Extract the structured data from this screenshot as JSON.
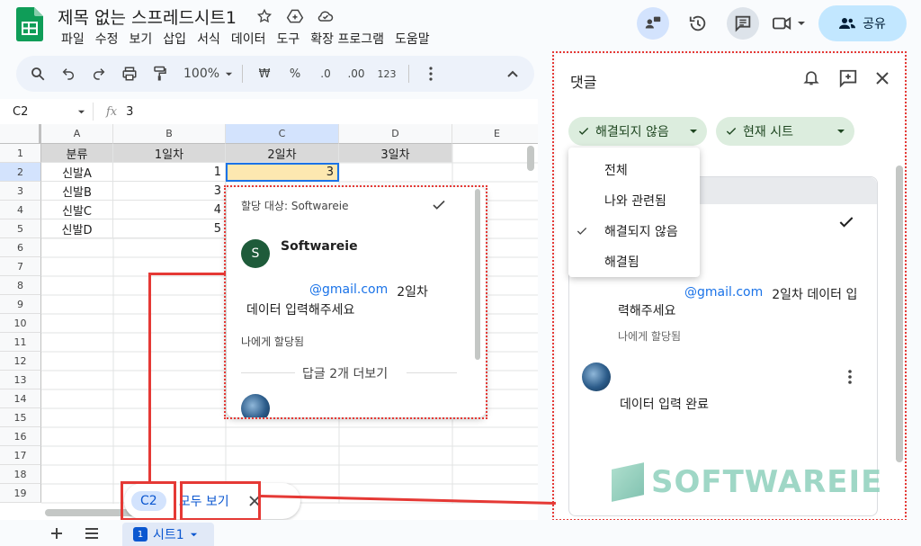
{
  "header": {
    "title": "제목 없는 스프레드시트1",
    "menu": [
      "파일",
      "수정",
      "보기",
      "삽입",
      "서식",
      "데이터",
      "도구",
      "확장 프로그램",
      "도움말"
    ],
    "share_label": "공유"
  },
  "toolbar": {
    "zoom": "100%",
    "currency": "₩",
    "percent": "%",
    "dec_dec": ".0",
    "inc_dec": ".00",
    "format_123": "123"
  },
  "formula_bar": {
    "cell_ref": "C2",
    "fx": "fx",
    "value": "3"
  },
  "grid": {
    "columns": [
      "A",
      "B",
      "C",
      "D",
      "E"
    ],
    "rows": [
      "1",
      "2",
      "3",
      "4",
      "5",
      "6",
      "7",
      "8",
      "9",
      "10",
      "11",
      "12",
      "13",
      "14",
      "15",
      "16",
      "17",
      "18",
      "19"
    ],
    "header_row": [
      "분류",
      "1일차",
      "2일차",
      "3일차"
    ],
    "data": [
      {
        "a": "신발A",
        "b": "1",
        "c": "3"
      },
      {
        "a": "신발B",
        "b": "3",
        "c": ""
      },
      {
        "a": "신발C",
        "b": "4",
        "c": ""
      },
      {
        "a": "신발D",
        "b": "5",
        "c": ""
      }
    ]
  },
  "popup": {
    "assigned": "할당 대상: Softwareie",
    "author": "Softwareie",
    "avatar_letter": "S",
    "email": "@gmail.com",
    "text_a": "2일차",
    "text_b": "데이터 입력해주세요",
    "assigned_to_me": "나에게 할당됨",
    "more_replies": "답글 2개 더보기"
  },
  "explore_bar": {
    "cell_chip": "C2",
    "see_all": "모두 보기"
  },
  "panel": {
    "title": "댓글",
    "filter_status": "해결되지 않음",
    "filter_sheet": "현재 시트",
    "dropdown": [
      "전체",
      "나와 관련됨",
      "해결되지 않음",
      "해결됨"
    ],
    "dropdown_selected": "해결되지 않음",
    "email": "@gmail.com",
    "comment_a": "2일차 데이터 입",
    "comment_b": "력해주세요",
    "assigned_to_me": "나에게 할당됨",
    "reply": "데이터 입력 완료"
  },
  "watermark": "SOFTWAREIE",
  "sheet_tab": {
    "num": "1",
    "name": "시트1"
  },
  "colors": {
    "accent": "#0b57d0",
    "annotation": "#e53935",
    "sheets_green": "#188038"
  }
}
